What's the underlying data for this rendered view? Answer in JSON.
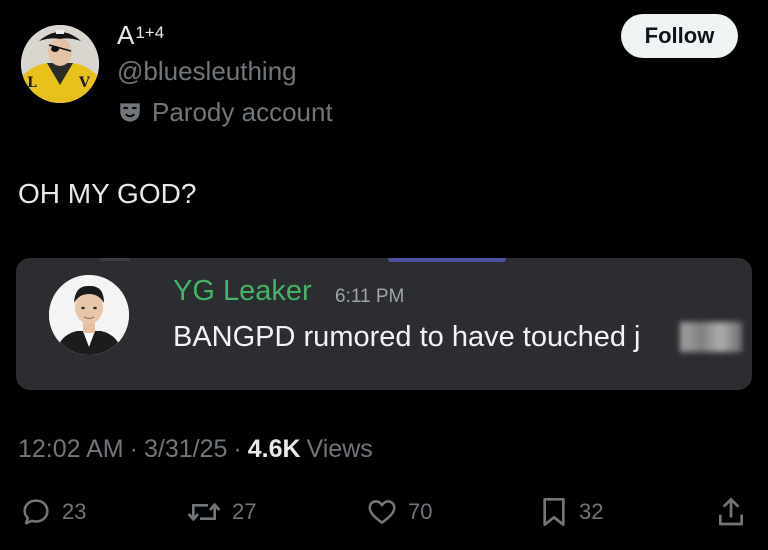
{
  "author": {
    "display_name": "A",
    "display_name_sup": "1+4",
    "handle": "@bluesleuthing",
    "label": "Parody account"
  },
  "follow_label": "Follow",
  "tweet": {
    "text": "OH MY GOD?"
  },
  "embed": {
    "username": "YG Leaker",
    "time": "6:11 PM",
    "message": "BANGPD rumored to have touched j",
    "username_color": "#43b365"
  },
  "meta": {
    "time": "12:02 AM",
    "date": "3/31/25",
    "views_count": "4.6K",
    "views_label": "Views"
  },
  "actions": {
    "replies": "23",
    "reposts": "27",
    "likes": "70",
    "bookmarks": "32"
  },
  "icons": {
    "reply": "reply-icon",
    "repost": "repost-icon",
    "like": "heart-icon",
    "bookmark": "bookmark-icon",
    "share": "share-icon",
    "parody": "mask-icon"
  }
}
